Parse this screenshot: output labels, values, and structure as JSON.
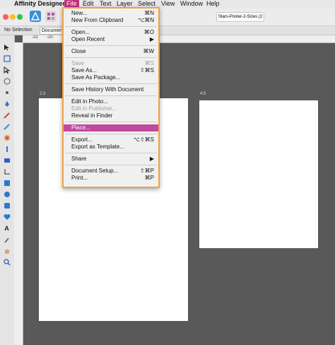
{
  "menubar": {
    "apple": "",
    "app": "Affinity Designer",
    "items": [
      "File",
      "Edit",
      "Text",
      "Layer",
      "Select",
      "View",
      "Window",
      "Help"
    ]
  },
  "toolbar": {
    "document_name": "Stars-Poster-2-Sizes (2"
  },
  "context": {
    "selection": "No Selection",
    "document_button": "Document"
  },
  "ruler": {
    "labels": [
      "-22",
      "-20"
    ]
  },
  "artboards": [
    {
      "label": "2:3"
    },
    {
      "label": "4:5"
    }
  ],
  "file_menu": [
    {
      "label": "New...",
      "shortcut": "⌘N",
      "enabled": true
    },
    {
      "label": "New From Clipboard",
      "shortcut": "⌥⌘N",
      "enabled": true
    },
    {
      "sep": true
    },
    {
      "label": "Open...",
      "shortcut": "⌘O",
      "enabled": true
    },
    {
      "label": "Open Recent",
      "shortcut": "▶",
      "enabled": true
    },
    {
      "sep": true
    },
    {
      "label": "Close",
      "shortcut": "⌘W",
      "enabled": true
    },
    {
      "sep": true
    },
    {
      "label": "Save",
      "shortcut": "⌘S",
      "enabled": false
    },
    {
      "label": "Save As...",
      "shortcut": "⇧⌘S",
      "enabled": true
    },
    {
      "label": "Save As Package...",
      "shortcut": "",
      "enabled": true
    },
    {
      "sep": true
    },
    {
      "label": "Save History With Document",
      "shortcut": "",
      "enabled": true
    },
    {
      "sep": true
    },
    {
      "label": "Edit in Photo...",
      "shortcut": "",
      "enabled": true
    },
    {
      "label": "Edit in Publisher...",
      "shortcut": "",
      "enabled": false
    },
    {
      "label": "Reveal in Finder",
      "shortcut": "",
      "enabled": true
    },
    {
      "sep": true
    },
    {
      "label": "Place...",
      "shortcut": "",
      "enabled": true,
      "highlighted": true
    },
    {
      "sep": true
    },
    {
      "label": "Export...",
      "shortcut": "⌥⇧⌘S",
      "enabled": true
    },
    {
      "label": "Export as Template...",
      "shortcut": "",
      "enabled": true
    },
    {
      "sep": true
    },
    {
      "label": "Share",
      "shortcut": "▶",
      "enabled": true
    },
    {
      "sep": true
    },
    {
      "label": "Document Setup...",
      "shortcut": "⇧⌘P",
      "enabled": true
    },
    {
      "label": "Print...",
      "shortcut": "⌘P",
      "enabled": true
    }
  ],
  "colors": {
    "accent": "#c04a9d",
    "highlight_border": "#f0a048",
    "canvas": "#595959"
  }
}
